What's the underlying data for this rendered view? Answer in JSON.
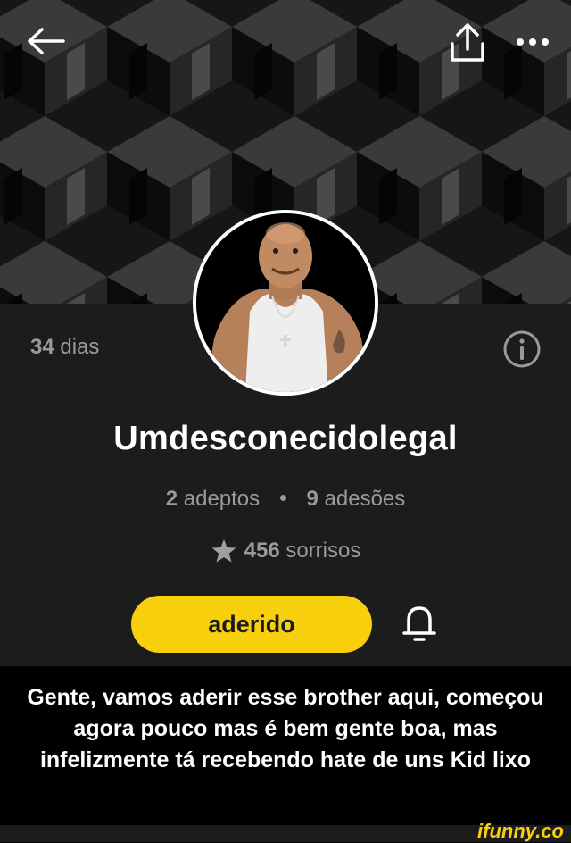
{
  "header": {
    "back_icon": "arrow-left-icon",
    "share_icon": "share-upload-icon",
    "more_icon": "more-dots-icon"
  },
  "profile": {
    "days_count": "34",
    "days_label": "dias",
    "info_icon": "info-circle-icon",
    "username": "Umdesconecidolegal",
    "followers_count": "2",
    "followers_label": "adeptos",
    "following_count": "9",
    "following_label": "adesões",
    "smiles_icon": "star-icon",
    "smiles_count": "456",
    "smiles_label": "sorrisos",
    "subscribe_label": "aderido",
    "bell_icon": "bell-icon"
  },
  "caption": {
    "text": "Gente, vamos aderir esse brother aqui, começou agora pouco mas é bem gente boa, mas infelizmente tá recebendo hate de uns Kid lixo"
  },
  "watermark": "ifunny.co",
  "colors": {
    "accent": "#f8cf0c",
    "panel": "#1c1c1c",
    "muted_text": "#9a9a9a"
  }
}
